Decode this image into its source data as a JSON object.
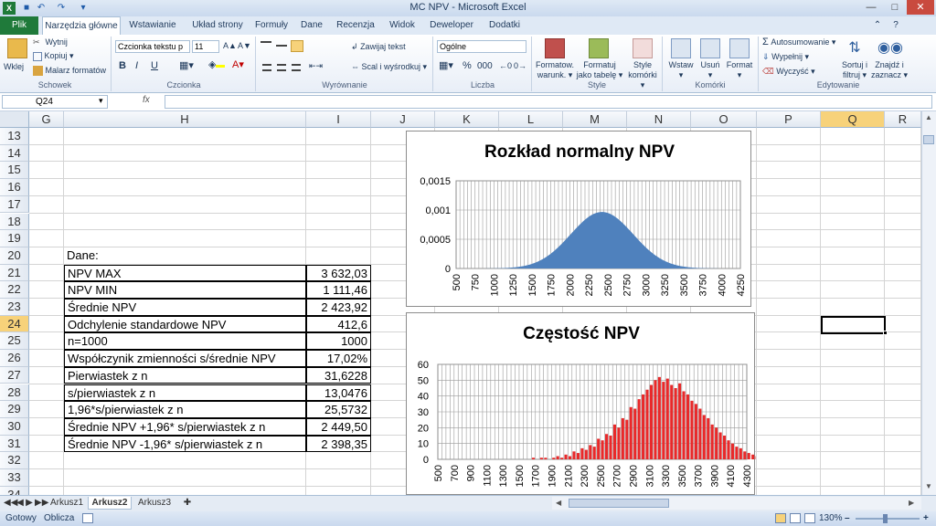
{
  "window": {
    "title": "MC NPV  -  Microsoft Excel"
  },
  "ribbon_tabs": {
    "file": "Plik",
    "items": [
      "Narzędzia główne",
      "Wstawianie",
      "Układ strony",
      "Formuły",
      "Dane",
      "Recenzja",
      "Widok",
      "Deweloper",
      "Dodatki"
    ]
  },
  "ribbon": {
    "clipboard": {
      "paste": "Wklej",
      "cut": "Wytnij",
      "copy": "Kopiuj",
      "painter": "Malarz formatów",
      "group": "Schowek"
    },
    "font": {
      "name": "Czcionka tekstu p",
      "size": "11",
      "bold": "B",
      "italic": "I",
      "underline": "U",
      "group": "Czcionka"
    },
    "alignment": {
      "wrap": "Zawijaj tekst",
      "merge": "Scal i wyśrodkuj",
      "group": "Wyrównanie"
    },
    "number": {
      "format": "Ogólne",
      "percent": "%",
      "thousands": "000",
      "group": "Liczba"
    },
    "styles": {
      "cond1": "Formatow.",
      "cond2": "warunk.",
      "table1": "Formatuj",
      "table2": "jako tabelę",
      "cell1": "Style",
      "cell2": "komórki",
      "group": "Style"
    },
    "cells": {
      "insert": "Wstaw",
      "delete": "Usuń",
      "format": "Format",
      "group": "Komórki"
    },
    "editing": {
      "autosum": "Autosumowanie",
      "fill": "Wypełnij",
      "clear": "Wyczyść",
      "sort1": "Sortuj i",
      "sort2": "filtruj",
      "find1": "Znajdź i",
      "find2": "zaznacz",
      "group": "Edytowanie"
    }
  },
  "formula_bar": {
    "name_box": "Q24",
    "fx": "fx"
  },
  "columns": [
    "G",
    "H",
    "I",
    "J",
    "K",
    "L",
    "M",
    "N",
    "O",
    "P",
    "Q",
    "R"
  ],
  "rows": [
    "13",
    "14",
    "15",
    "16",
    "17",
    "18",
    "19",
    "20",
    "21",
    "22",
    "23",
    "24",
    "25",
    "26",
    "27",
    "28",
    "29",
    "30",
    "31",
    "32",
    "33",
    "34"
  ],
  "table": {
    "header": "Dane:",
    "rows": [
      {
        "label": "NPV MAX",
        "value": "3 632,03"
      },
      {
        "label": "NPV MIN",
        "value": "1 111,46"
      },
      {
        "label": "Średnie NPV",
        "value": "2 423,92"
      },
      {
        "label": "Odchylenie standardowe NPV",
        "value": "412,6"
      },
      {
        "label": "n=1000",
        "value": "1000"
      },
      {
        "label": "Współczynik zmienności s/średnie NPV",
        "value": "17,02%"
      },
      {
        "label": "Pierwiastek z n",
        "value": "31,6228"
      },
      {
        "label": "s/pierwiastek z n",
        "value": "13,0476"
      },
      {
        "label": "1,96*s/pierwiastek z n",
        "value": "25,5732"
      },
      {
        "label": "Średnie NPV +1,96* s/pierwiastek z n",
        "value": "2 449,50"
      },
      {
        "label": "Średnie NPV -1,96* s/pierwiastek z n",
        "value": "2 398,35"
      }
    ]
  },
  "chart_data": [
    {
      "type": "area",
      "title": "Rozkład normalny NPV",
      "mean": 2423.92,
      "sd": 412.6,
      "x_ticks": [
        "500",
        "750",
        "1000",
        "1250",
        "1500",
        "1750",
        "2000",
        "2250",
        "2500",
        "2750",
        "3000",
        "3250",
        "3500",
        "3750",
        "4000",
        "4250"
      ],
      "y_ticks": [
        "0",
        "0,0005",
        "0,001",
        "0,0015"
      ],
      "xlim": [
        500,
        4250
      ],
      "ylim": [
        0,
        0.0015
      ],
      "grid": true,
      "color": "#4f81bd"
    },
    {
      "type": "bar",
      "title": "Częstość NPV",
      "x_ticks": [
        "500",
        "700",
        "900",
        "1100",
        "1300",
        "1500",
        "1700",
        "1900",
        "2100",
        "2300",
        "2500",
        "2700",
        "2900",
        "3100",
        "3300",
        "3500",
        "3700",
        "3900",
        "4100",
        "4300"
      ],
      "y_ticks": [
        "0",
        "10",
        "20",
        "30",
        "40",
        "50",
        "60"
      ],
      "xlim": [
        500,
        4300
      ],
      "ylim": [
        0,
        60
      ],
      "bin_start": 500,
      "bin_width": 50,
      "values": [
        0,
        0,
        0,
        0,
        0,
        0,
        0,
        0,
        0,
        0,
        0,
        0,
        0,
        0,
        0,
        0,
        0,
        0,
        0,
        0,
        0,
        0,
        0,
        1,
        0,
        1,
        1,
        0,
        1,
        2,
        1,
        3,
        2,
        5,
        4,
        7,
        6,
        9,
        8,
        13,
        12,
        16,
        15,
        22,
        20,
        26,
        25,
        33,
        32,
        38,
        41,
        44,
        47,
        50,
        52,
        49,
        51,
        47,
        45,
        48,
        43,
        41,
        37,
        35,
        32,
        28,
        26,
        22,
        20,
        17,
        15,
        12,
        10,
        8,
        7,
        5,
        4,
        3,
        2,
        2,
        1,
        1,
        0,
        0,
        0,
        0,
        0,
        0,
        0,
        0,
        0,
        0,
        0,
        0,
        0,
        0
      ],
      "grid": true,
      "color": "#e8292a"
    }
  ],
  "sheet_tabs": [
    "Arkusz1",
    "Arkusz2",
    "Arkusz3"
  ],
  "active_sheet": "Arkusz2",
  "status": {
    "ready": "Gotowy",
    "calc": "Oblicza",
    "zoom": "130%",
    "zoom_minus": "–",
    "zoom_plus": "+"
  },
  "colors": {
    "selection": "#f7d27a",
    "ribbon": "#dfe9f5",
    "file_tab": "#1f7a3a"
  }
}
